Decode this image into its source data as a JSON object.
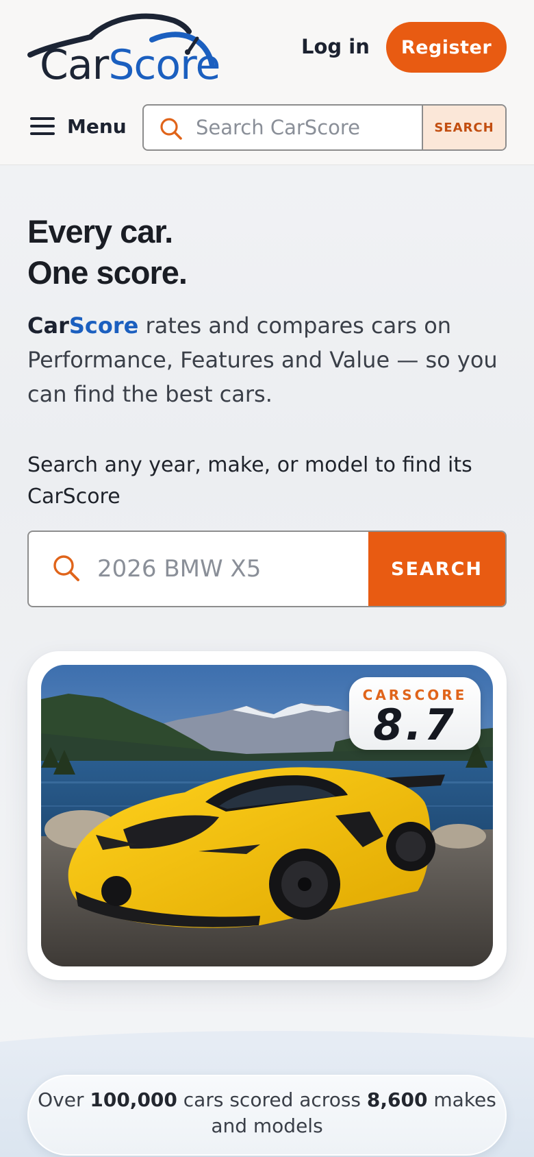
{
  "header": {
    "logo_part1": "Car",
    "logo_part2": "Score",
    "login_label": "Log in",
    "register_label": "Register",
    "menu_label": "Menu",
    "search_placeholder": "Search CarScore",
    "search_button": "SEARCH"
  },
  "hero": {
    "title_line1": "Every car.",
    "title_line2": "One score.",
    "desc_brand1": "Car",
    "desc_brand2": "Score",
    "desc_text": " rates and compares cars on Performance, Features and Value — so you can find the best cars.",
    "search_prompt": "Search any year, make, or model to find its CarScore",
    "search_placeholder": "2026 BMW X5",
    "search_button": "SEARCH"
  },
  "featured": {
    "score_label": "CARSCORE",
    "score_value": "8.7"
  },
  "stats": {
    "prefix": "Over ",
    "cars_count": "100,000",
    "middle": " cars scored across ",
    "makes_count": "8,600",
    "suffix": " makes and models"
  },
  "colors": {
    "accent_orange": "#e85b12",
    "brand_blue": "#1b5fbf",
    "text_dark": "#1c2230"
  },
  "icons": [
    "search-icon",
    "menu-icon",
    "logo-car-icon"
  ]
}
